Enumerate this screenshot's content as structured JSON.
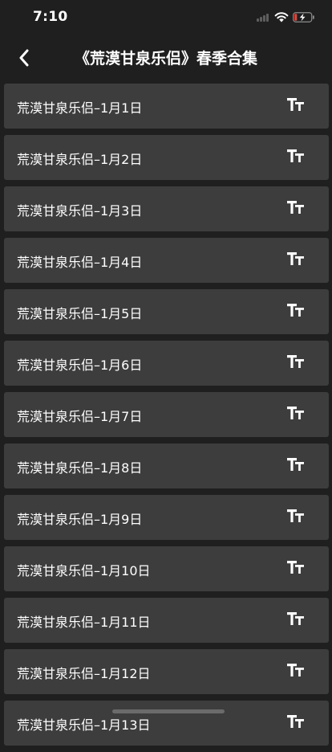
{
  "status_bar": {
    "time": "7:10"
  },
  "nav": {
    "title": "《荒漠甘泉乐侣》春季合集"
  },
  "colors": {
    "background": "#1f1f1f",
    "item_background": "#3d3d3d",
    "text": "#ffffff",
    "battery_low": "#ff3b30"
  },
  "icons": {
    "back": "chevron-left-icon",
    "font_size": "font-size-icon",
    "wifi": "wifi-icon",
    "signal": "cellular-signal-icon",
    "battery": "battery-charging-icon"
  },
  "items": [
    {
      "title": "荒漠甘泉乐侣–1月1日"
    },
    {
      "title": "荒漠甘泉乐侣–1月2日"
    },
    {
      "title": "荒漠甘泉乐侣–1月3日"
    },
    {
      "title": "荒漠甘泉乐侣–1月4日"
    },
    {
      "title": "荒漠甘泉乐侣–1月5日"
    },
    {
      "title": "荒漠甘泉乐侣–1月6日"
    },
    {
      "title": "荒漠甘泉乐侣–1月7日"
    },
    {
      "title": "荒漠甘泉乐侣–1月8日"
    },
    {
      "title": "荒漠甘泉乐侣–1月9日"
    },
    {
      "title": "荒漠甘泉乐侣–1月10日"
    },
    {
      "title": "荒漠甘泉乐侣–1月11日"
    },
    {
      "title": "荒漠甘泉乐侣–1月12日"
    },
    {
      "title": "荒漠甘泉乐侣–1月13日"
    }
  ]
}
